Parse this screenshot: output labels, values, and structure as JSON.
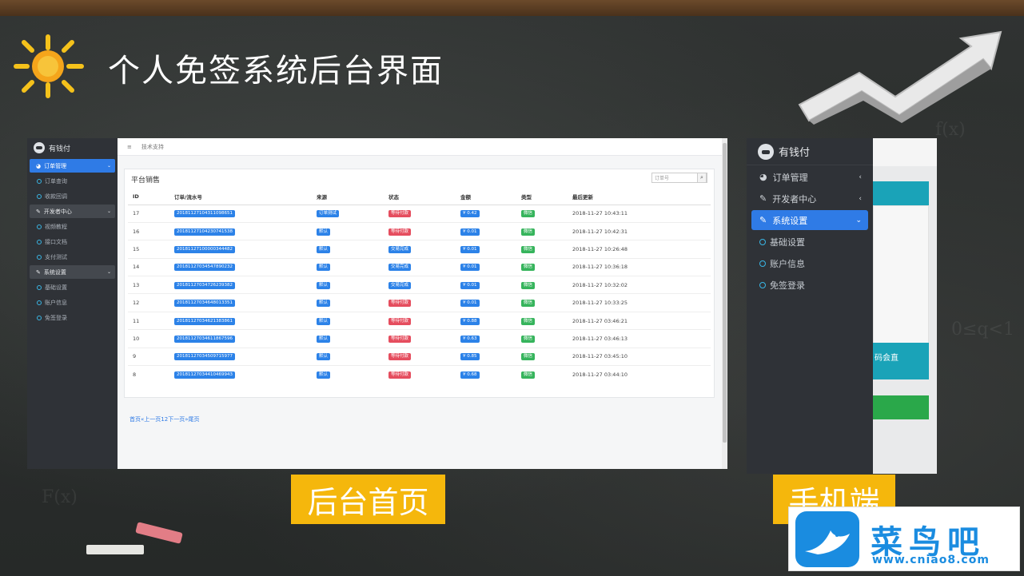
{
  "header": {
    "title": "个人免签系统后台界面"
  },
  "captions": {
    "admin": "后台首页",
    "mobile": "手机端"
  },
  "admin": {
    "brand": "有钱付",
    "topbar_link": "技术支持",
    "panel_title": "平台销售",
    "search_placeholder": "订单号",
    "menu": [
      {
        "label": "订单管理",
        "children": [
          "订单查询",
          "收款回调"
        ]
      },
      {
        "label": "开发者中心",
        "children": [
          "视频教程",
          "接口文档",
          "支付测试"
        ]
      },
      {
        "label": "系统设置",
        "children": [
          "基础设置",
          "账户信息",
          "免签登录"
        ]
      }
    ],
    "table": {
      "headers": [
        "ID",
        "订单/流水号",
        "来源",
        "状态",
        "金额",
        "类型",
        "最后更新"
      ],
      "rows": [
        {
          "id": "17",
          "order": "20181127104311098651",
          "source": "订单测试",
          "status": "等待付款",
          "status_color": "red",
          "amount": "¥ 0.42",
          "type": "微信",
          "updated": "2018-11-27 10:43:11"
        },
        {
          "id": "16",
          "order": "20181127104230741538",
          "source": "默认",
          "status": "等待付款",
          "status_color": "red",
          "amount": "¥ 0.01",
          "type": "微信",
          "updated": "2018-11-27 10:42:31"
        },
        {
          "id": "15",
          "order": "20181127100000344482",
          "source": "默认",
          "status": "交易完成",
          "status_color": "blue",
          "amount": "¥ 0.01",
          "type": "微信",
          "updated": "2018-11-27 10:26:48"
        },
        {
          "id": "14",
          "order": "20181127034547890232",
          "source": "默认",
          "status": "交易完成",
          "status_color": "blue",
          "amount": "¥ 0.01",
          "type": "微信",
          "updated": "2018-11-27 10:36:18"
        },
        {
          "id": "13",
          "order": "20181127034726239382",
          "source": "默认",
          "status": "交易完成",
          "status_color": "blue",
          "amount": "¥ 0.01",
          "type": "微信",
          "updated": "2018-11-27 10:32:02"
        },
        {
          "id": "12",
          "order": "20181127034648013351",
          "source": "默认",
          "status": "等待付款",
          "status_color": "red",
          "amount": "¥ 0.01",
          "type": "微信",
          "updated": "2018-11-27 10:33:25"
        },
        {
          "id": "11",
          "order": "20181127034621383861",
          "source": "默认",
          "status": "等待付款",
          "status_color": "red",
          "amount": "¥ 0.88",
          "type": "微信",
          "updated": "2018-11-27 03:46:21"
        },
        {
          "id": "10",
          "order": "20181127034611867596",
          "source": "默认",
          "status": "等待付款",
          "status_color": "red",
          "amount": "¥ 0.63",
          "type": "微信",
          "updated": "2018-11-27 03:46:13"
        },
        {
          "id": "9",
          "order": "20181127034509715977",
          "source": "默认",
          "status": "等待付款",
          "status_color": "red",
          "amount": "¥ 0.85",
          "type": "微信",
          "updated": "2018-11-27 03:45:10"
        },
        {
          "id": "8",
          "order": "20181127034410469943",
          "source": "默认",
          "status": "等待付款",
          "status_color": "red",
          "amount": "¥ 0.68",
          "type": "微信",
          "updated": "2018-11-27 03:44:10"
        }
      ]
    },
    "pagination": "首页«上一页12下一页»尾页"
  },
  "mobile": {
    "brand": "有钱付",
    "menu": [
      "订单管理",
      "开发者中心",
      "系统设置"
    ],
    "submenu": [
      "基础设置",
      "账户信息",
      "免签登录"
    ],
    "card_text": "码会直"
  },
  "watermark": {
    "title": "菜鸟吧",
    "url": "www.cniao8.com"
  },
  "colors": {
    "accent": "#2f7be6",
    "caption": "#f5b70c",
    "sidebar": "#2f3237",
    "status_red": "#e54d5e",
    "status_blue": "#2c82e8",
    "type_green": "#36b45c"
  }
}
